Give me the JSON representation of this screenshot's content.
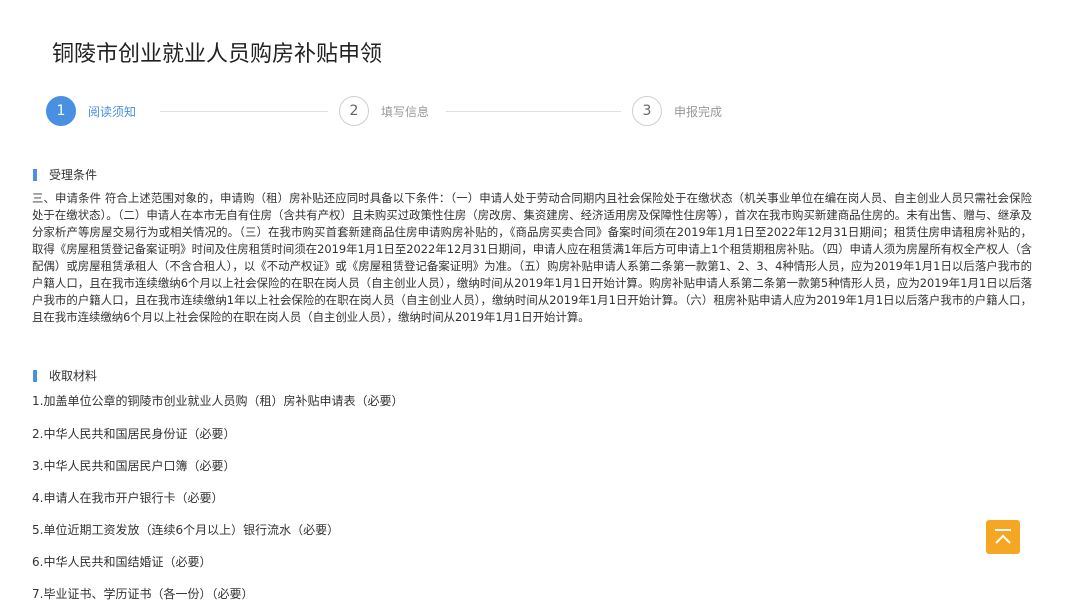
{
  "page_title": "铜陵市创业就业人员购房补贴申领",
  "steps": [
    {
      "number": "1",
      "label": "阅读须知",
      "active": true
    },
    {
      "number": "2",
      "label": "填写信息",
      "active": false
    },
    {
      "number": "3",
      "label": "申报完成",
      "active": false
    }
  ],
  "conditions": {
    "heading": "受理条件",
    "text": "三、申请条件 符合上述范围对象的，申请购（租）房补贴还应同时具备以下条件：（一）申请人处于劳动合同期内且社会保险处于在缴状态（机关事业单位在编在岗人员、自主创业人员只需社会保险处于在缴状态）。（二）申请人在本市无自有住房（含共有产权）且未购买过政策性住房（房改房、集资建房、经济适用房及保障性住房等），首次在我市购买新建商品住房的。未有出售、赠与、继承及分家析产等房屋交易行为或相关情况的。（三）在我市购买首套新建商品住房申请购房补贴的，《商品房买卖合同》备案时间须在2019年1月1日至2022年12月31日期间；租赁住房申请租房补贴的，取得《房屋租赁登记备案证明》时间及住房租赁时间须在2019年1月1日至2022年12月31日期间，申请人应在租赁满1年后方可申请上1个租赁期租房补贴。（四）申请人须为房屋所有权全产权人（含配偶）或房屋租赁承租人（不含合租人），以《不动产权证》或《房屋租赁登记备案证明》为准。（五）购房补贴申请人系第二条第一款第1、2、3、4种情形人员，应为2019年1月1日以后落户我市的户籍人口，且在我市连续缴纳6个月以上社会保险的在职在岗人员（自主创业人员），缴纳时间从2019年1月1日开始计算。购房补贴申请人系第二条第一款第5种情形人员，应为2019年1月1日以后落户我市的户籍人口，且在我市连续缴纳1年以上社会保险的在职在岗人员（自主创业人员），缴纳时间从2019年1月1日开始计算。（六）租房补贴申请人应为2019年1月1日以后落户我市的户籍人口，且在我市连续缴纳6个月以上社会保险的在职在岗人员（自主创业人员），缴纳时间从2019年1月1日开始计算。"
  },
  "materials": {
    "heading": "收取材料",
    "items": [
      "1.加盖单位公章的铜陵市创业就业人员购（租）房补贴申请表（必要）",
      "2.中华人民共和国居民身份证（必要）",
      "3.中华人民共和国居民户口簿（必要）",
      "4.申请人在我市开户银行卡（必要）",
      "5.单位近期工资发放（连续6个月以上）银行流水（必要）",
      "6.中华人民共和国结婚证（必要）",
      "7.毕业证书、学历证书（各一份）（必要）"
    ]
  },
  "back_to_top": {
    "icon": "arrow-up-to-top-icon",
    "color": "#f5a623"
  },
  "colors": {
    "accent": "#4a90e2"
  }
}
